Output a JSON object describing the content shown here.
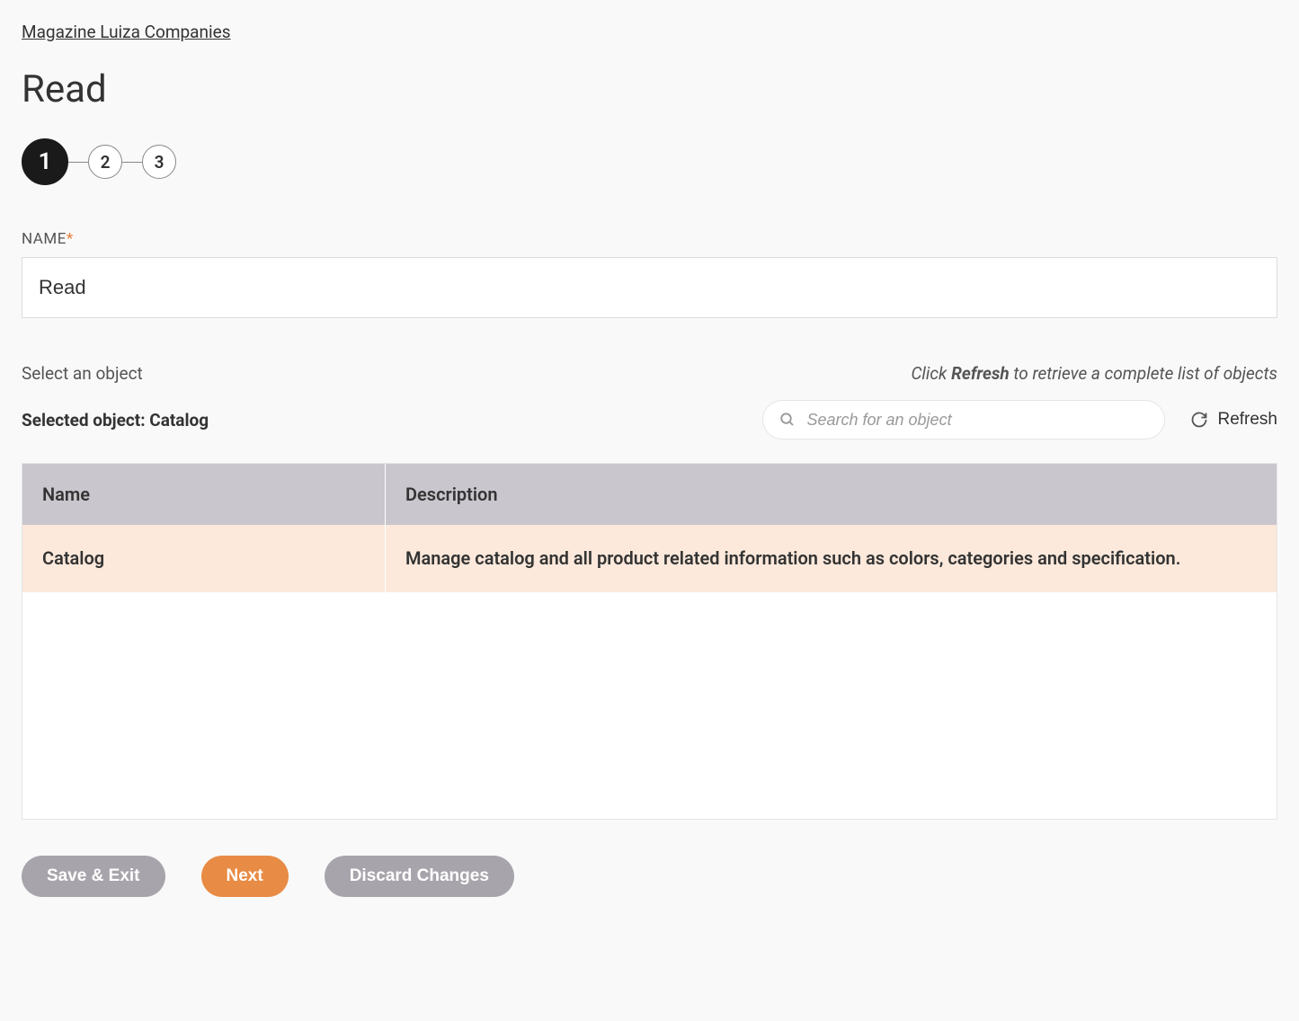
{
  "breadcrumb": "Magazine Luiza Companies",
  "page_title": "Read",
  "stepper": {
    "steps": [
      "1",
      "2",
      "3"
    ],
    "active_index": 0
  },
  "name_field": {
    "label": "NAME",
    "required_marker": "*",
    "value": "Read"
  },
  "object_section": {
    "select_label": "Select an object",
    "hint_pre": "Click ",
    "hint_bold": "Refresh",
    "hint_post": " to retrieve a complete list of objects",
    "selected_prefix": "Selected object: ",
    "selected_value": "Catalog",
    "search_placeholder": "Search for an object",
    "refresh_label": "Refresh"
  },
  "table": {
    "headers": {
      "name": "Name",
      "description": "Description"
    },
    "rows": [
      {
        "name": "Catalog",
        "description": "Manage catalog and all product related information such as colors, categories and specification.",
        "selected": true
      }
    ]
  },
  "actions": {
    "save_exit": "Save & Exit",
    "next": "Next",
    "discard": "Discard Changes"
  }
}
